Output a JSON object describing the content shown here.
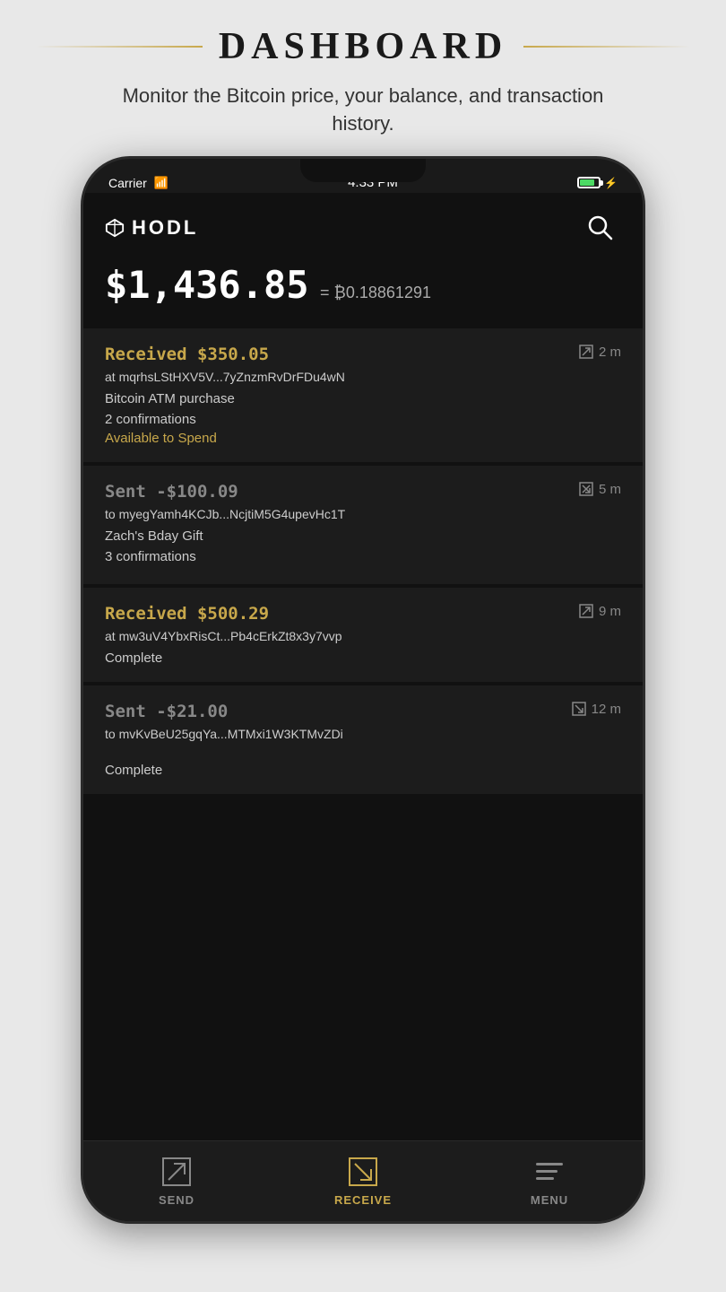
{
  "page": {
    "title": "DASHBOARD",
    "subtitle": "Monitor the Bitcoin price, your balance, and transaction history."
  },
  "status_bar": {
    "carrier": "Carrier",
    "time": "4:33 PM"
  },
  "app": {
    "logo": "◆HODL",
    "logo_text": "HODL"
  },
  "balance": {
    "usd": "$1,436.85",
    "btc_prefix": "= ₿",
    "btc": "0.18861291"
  },
  "transactions": [
    {
      "type": "received",
      "amount": "Received $350.05",
      "address": "at mqrhsLStHXV5V...7yZnzmRvDrFDu4wN",
      "label": "Bitcoin ATM purchase",
      "confirmations": "2 confirmations",
      "status": "Available to Spend",
      "time": "2 m",
      "status_type": "available"
    },
    {
      "type": "sent",
      "amount": "Sent -$100.09",
      "address": "to myegYamh4KCJb...NcjtiM5G4upevHc1T",
      "label": "Zach's Bday Gift",
      "confirmations": "3 confirmations",
      "status": "",
      "time": "5 m",
      "status_type": "none"
    },
    {
      "type": "received",
      "amount": "Received $500.29",
      "address": "at mw3uV4YbxRisCt...Pb4cErkZt8x3y7vvp",
      "label": "",
      "confirmations": "",
      "status": "Complete",
      "time": "9 m",
      "status_type": "complete"
    },
    {
      "type": "sent",
      "amount": "Sent -$21.00",
      "address": "to mvKvBeU25gqYa...MTMxi1W3KTMvZDi",
      "label": "",
      "confirmations": "",
      "status": "Complete",
      "time": "12 m",
      "status_type": "complete"
    }
  ],
  "nav": {
    "send_label": "SEND",
    "receive_label": "RECEIVE",
    "menu_label": "MENU"
  }
}
